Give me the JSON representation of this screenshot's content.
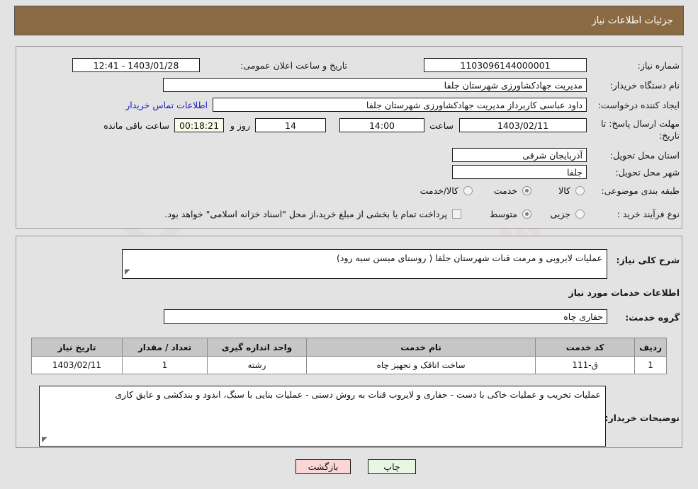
{
  "header": {
    "title": "جزئیات اطلاعات نیاز"
  },
  "form": {
    "need_number_label": "شماره نیاز:",
    "need_number_value": "1103096144000001",
    "public_announce_label": "تاریخ و ساعت اعلان عمومی:",
    "public_announce_value": "1403/01/28 - 12:41",
    "buyer_org_label": "نام دستگاه خریدار:",
    "buyer_org_value": "مدیریت جهادکشاورزی شهرستان جلفا",
    "creator_label": "ایجاد کننده درخواست:",
    "creator_value": "داود عباسی کاربرداز مدیریت جهادکشاورزی شهرستان جلفا",
    "contact_link": "اطلاعات تماس خریدار",
    "deadline_label": "مهلت ارسال پاسخ: تا تاریخ:",
    "deadline_date": "1403/02/11",
    "time_label": "ساعت",
    "deadline_time": "14:00",
    "days_value": "14",
    "days_label": "روز و",
    "timer_value": "00:18:21",
    "remaining_label": "ساعت باقی مانده",
    "province_label": "استان محل تحویل:",
    "province_value": "آذربایجان شرقی",
    "city_label": "شهر محل تحویل:",
    "city_value": "جلفا",
    "category_label": "طبقه بندی موضوعی:",
    "category_options": [
      {
        "label": "کالا",
        "selected": false
      },
      {
        "label": "خدمت",
        "selected": true
      },
      {
        "label": "کالا/خدمت",
        "selected": false
      }
    ],
    "process_label": "نوع فرآیند خرید :",
    "process_options": [
      {
        "label": "جزیی",
        "selected": false
      },
      {
        "label": "متوسط",
        "selected": true
      }
    ],
    "treasury_note": "پرداخت تمام یا بخشی از مبلغ خرید،از محل \"اسناد خزانه اسلامی\" خواهد بود."
  },
  "description": {
    "general_label": "شرح کلی نیاز:",
    "general_value": "عملیات لایروبی و مرمت قنات شهرستان جلفا ( روستای میسن سیه رود)",
    "section_heading": "اطلاعات خدمات مورد نیاز",
    "service_group_label": "گروه خدمت:",
    "service_group_value": "حفاری چاه"
  },
  "table": {
    "headers": [
      "ردیف",
      "کد خدمت",
      "نام خدمت",
      "واحد اندازه گیری",
      "تعداد / مقدار",
      "تاریخ نیاز"
    ],
    "rows": [
      {
        "row": "1",
        "service_code": "ق-111",
        "service_name": "ساخت اتاقک و تجهیز چاه",
        "unit": "رشته",
        "quantity": "1",
        "need_date": "1403/02/11"
      }
    ]
  },
  "notes": {
    "label": "توضیحات خریدار:",
    "value": "عملیات تخریب و عملیات خاکی با دست - حفاری و لایروب قنات به روش دستی - عملیات بنایی با سنگ، اندود و بندکشی و عایق کاری"
  },
  "buttons": {
    "print": "چاپ",
    "back": "بازگشت"
  },
  "colors": {
    "header_bg": "#8a6a42",
    "page_bg": "#e3e3e3",
    "link": "#1a1acc",
    "print_btn": "#e8f7e4",
    "back_btn": "#fbd6d6",
    "timer_bg": "#fbfbe8",
    "table_header_bg": "#c6c6c6"
  }
}
